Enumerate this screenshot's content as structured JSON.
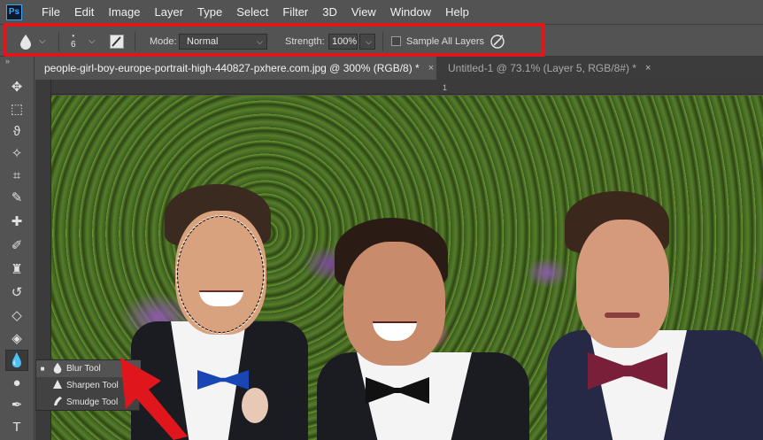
{
  "app": {
    "logo_text": "Ps"
  },
  "menu": [
    "File",
    "Edit",
    "Image",
    "Layer",
    "Type",
    "Select",
    "Filter",
    "3D",
    "View",
    "Window",
    "Help"
  ],
  "options": {
    "brush_size": "6",
    "mode_label": "Mode:",
    "mode_value": "Normal",
    "strength_label": "Strength:",
    "strength_value": "100%",
    "sample_all_layers_label": "Sample All Layers",
    "sample_all_layers_checked": false
  },
  "tabs": [
    {
      "label": "people-girl-boy-europe-portrait-high-440827-pxhere.com.jpg @ 300% (RGB/8) *",
      "close": "×",
      "active": true
    },
    {
      "label": "Untitled-1 @ 73.1% (Layer 5, RGB/8#) *",
      "close": "×",
      "active": false
    }
  ],
  "ruler": {
    "tick_label": "1"
  },
  "toolbar": {
    "grip": "»",
    "tools": [
      {
        "name": "move-tool",
        "glyph": "✥"
      },
      {
        "name": "marquee-tool",
        "glyph": "⬚"
      },
      {
        "name": "lasso-tool",
        "glyph": "ϑ"
      },
      {
        "name": "magic-wand-tool",
        "glyph": "✧"
      },
      {
        "name": "crop-tool",
        "glyph": "⌗"
      },
      {
        "name": "eyedropper-tool",
        "glyph": "✎"
      },
      {
        "name": "healing-brush-tool",
        "glyph": "✚"
      },
      {
        "name": "brush-tool",
        "glyph": "✐"
      },
      {
        "name": "clone-stamp-tool",
        "glyph": "♜"
      },
      {
        "name": "history-brush-tool",
        "glyph": "↺"
      },
      {
        "name": "eraser-tool",
        "glyph": "◇"
      },
      {
        "name": "paint-bucket-tool",
        "glyph": "◈"
      },
      {
        "name": "blur-tool",
        "glyph": "💧"
      },
      {
        "name": "dodge-tool",
        "glyph": "●"
      },
      {
        "name": "pen-tool",
        "glyph": "✒"
      },
      {
        "name": "type-tool",
        "glyph": "T"
      }
    ]
  },
  "flyout": {
    "items": [
      {
        "label": "Blur Tool",
        "icon": "💧",
        "selected": true,
        "dot": "■"
      },
      {
        "label": "Sharpen Tool",
        "icon": "▲",
        "selected": false,
        "dot": ""
      },
      {
        "label": "Smudge Tool",
        "icon": "☚",
        "selected": false,
        "dot": ""
      }
    ]
  },
  "colors": {
    "highlight": "#e0161d",
    "panel": "#535353",
    "dark": "#3c3c3c"
  }
}
